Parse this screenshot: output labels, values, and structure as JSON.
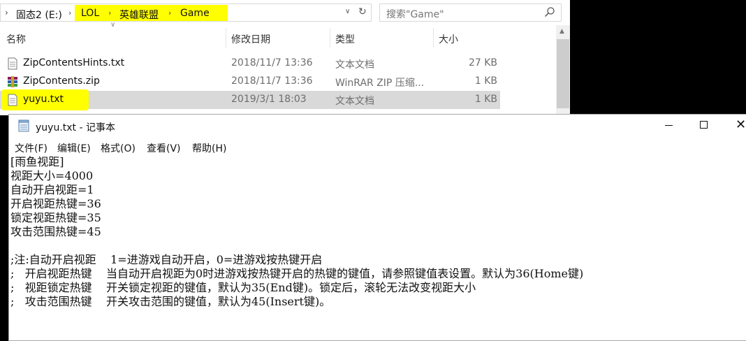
{
  "explorer": {
    "breadcrumb": [
      "固态2 (E:)",
      "LOL",
      "英雄联盟",
      "Game"
    ],
    "search_placeholder": "搜索\"Game\"",
    "columns": [
      "名称",
      "修改日期",
      "类型",
      "大小"
    ],
    "files": [
      {
        "name": "ZipContentsHints.txt",
        "date": "2018/11/7 13:36",
        "type": "文本文档",
        "size": "27 KB",
        "icon": "text-file-icon"
      },
      {
        "name": "ZipContents.zip",
        "date": "2018/11/7 13:36",
        "type": "WinRAR ZIP 压缩...",
        "size": "1 KB",
        "icon": "winrar-archive-icon"
      },
      {
        "name": "yuyu.txt",
        "date": "2019/3/1 18:03",
        "type": "文本文档",
        "size": "1 KB",
        "icon": "text-file-icon"
      }
    ],
    "highlight_color": "#ffff00"
  },
  "notepad": {
    "title": "yuyu.txt - 记事本",
    "menu": [
      "文件(F)",
      "编辑(E)",
      "格式(O)",
      "查看(V)",
      "帮助(H)"
    ],
    "lines": [
      "[雨鱼视距]",
      "视距大小=4000",
      "自动开启视距=1",
      "开启视距热键=36",
      "锁定视距热键=35",
      "攻击范围热键=45",
      "",
      ";注:自动开启视距    1=进游戏自动开启，0=进游戏按热键开启",
      ";   开启视距热键    当自动开启视距为0时进游戏按热键开启的热键的键值，请参照键值表设置。默认为36(Home键)",
      ";   视距锁定热键    开关锁定视距的键值，默认为35(End键)。锁定后，滚轮无法改变视距大小",
      ";   攻击范围热键    开关攻击范围的键值，默认为45(Insert键)。"
    ]
  }
}
